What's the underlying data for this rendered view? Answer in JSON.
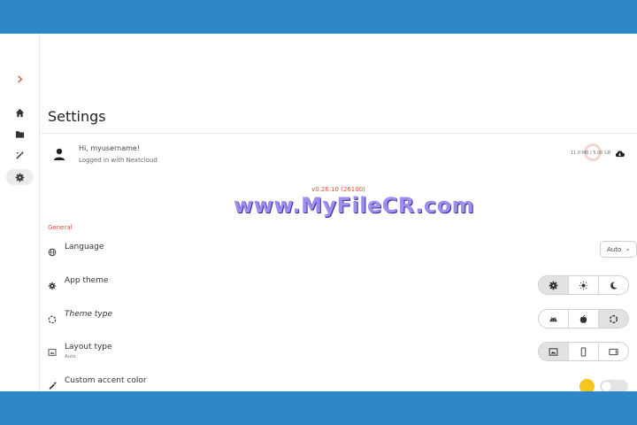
{
  "colors": {
    "band": "#2e87c8",
    "accent": "#e0523f",
    "accent_color_swatch": "#f7c51c"
  },
  "sidebar": {
    "items": [
      {
        "icon": "chevron-right-icon",
        "active": false
      },
      {
        "icon": "home-icon",
        "active": false
      },
      {
        "icon": "folder-icon",
        "active": false
      },
      {
        "icon": "magic-wand-icon",
        "active": false
      },
      {
        "icon": "gear-icon",
        "active": true
      }
    ]
  },
  "page": {
    "title": "Settings"
  },
  "account": {
    "greeting": "Hi, myusername!",
    "subtitle": "Logged in with Nextcloud",
    "storage": "11.0 MB / 5.00 GB"
  },
  "app": {
    "version": "v0.26.10 (26100)"
  },
  "sections": {
    "general": "General"
  },
  "settings": {
    "language": {
      "label": "Language",
      "value": "Auto"
    },
    "app_theme": {
      "label": "App theme",
      "options": [
        "system-theme-icon",
        "light-sun-icon",
        "dark-moon-icon"
      ],
      "selected": 0
    },
    "theme_type": {
      "label": "Theme type",
      "options": [
        "android-icon",
        "apple-icon",
        "custom-circle-icon"
      ],
      "selected": 2
    },
    "layout_type": {
      "label": "Layout type",
      "subtitle": "Auto",
      "options": [
        "auto-layout-icon",
        "phone-icon",
        "tablet-icon"
      ],
      "selected": 0
    },
    "accent": {
      "label": "Custom accent color",
      "enabled": false
    }
  },
  "watermark": "www.MyFileCR.com"
}
